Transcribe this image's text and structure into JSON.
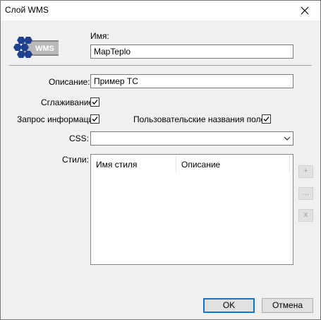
{
  "window": {
    "title": "Слой WMS"
  },
  "logo": {
    "text": "WMS"
  },
  "name": {
    "label": "Имя:",
    "value": "MapTeplo"
  },
  "description": {
    "label": "Описание:",
    "value": "Пример ТС"
  },
  "smoothing": {
    "label": "Сглаживание",
    "checked": true
  },
  "query_info": {
    "label": "Запрос информации",
    "checked": true
  },
  "custom_field_names": {
    "label": "Пользовательские названия полей",
    "checked": true
  },
  "css": {
    "label": "CSS:",
    "value": ""
  },
  "styles": {
    "label": "Стили:",
    "columns": [
      "Имя стиля",
      "Описание"
    ],
    "rows": [],
    "side_buttons": [
      "+",
      "...",
      "x"
    ]
  },
  "buttons": {
    "ok": "OK",
    "cancel": "Отмена"
  },
  "colors": {
    "accent": "#0078d7",
    "logo_blue": "#1f3f8f"
  },
  "icons": {
    "close": "close-icon",
    "dropdown": "chevron-down-icon",
    "check": "check-icon"
  }
}
